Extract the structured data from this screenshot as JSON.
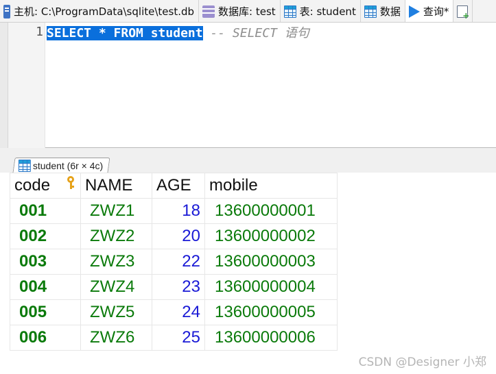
{
  "tabs": [
    {
      "label": "主机: C:\\ProgramData\\sqlite\\test.db",
      "icon": "host-icon"
    },
    {
      "label": "数据库: test",
      "icon": "database-icon"
    },
    {
      "label": "表: student",
      "icon": "table-icon"
    },
    {
      "label": "数据",
      "icon": "data-grid-icon"
    },
    {
      "label": "查询*",
      "icon": "play-icon",
      "active": true
    },
    {
      "label": "",
      "icon": "new-query-icon"
    }
  ],
  "editor": {
    "line_number": "1",
    "selected_sql": "SELECT * FROM student",
    "comment": " -- SELECT 语句"
  },
  "result_tab": {
    "label": "student (6r × 4c)"
  },
  "grid": {
    "columns": [
      "code",
      "NAME",
      "AGE",
      "mobile"
    ],
    "rows": [
      [
        "001",
        "ZWZ1",
        "18",
        "13600000001"
      ],
      [
        "002",
        "ZWZ2",
        "20",
        "13600000002"
      ],
      [
        "003",
        "ZWZ3",
        "22",
        "13600000003"
      ],
      [
        "004",
        "ZWZ4",
        "23",
        "13600000004"
      ],
      [
        "005",
        "ZWZ5",
        "24",
        "13600000005"
      ],
      [
        "006",
        "ZWZ6",
        "25",
        "13600000006"
      ]
    ]
  },
  "watermark": "CSDN @Designer 小郑",
  "colors": {
    "selection": "#0a6fdc",
    "text_value": "#0a7a0a",
    "number_value": "#1a1ad6",
    "key": "#e6a21a"
  }
}
